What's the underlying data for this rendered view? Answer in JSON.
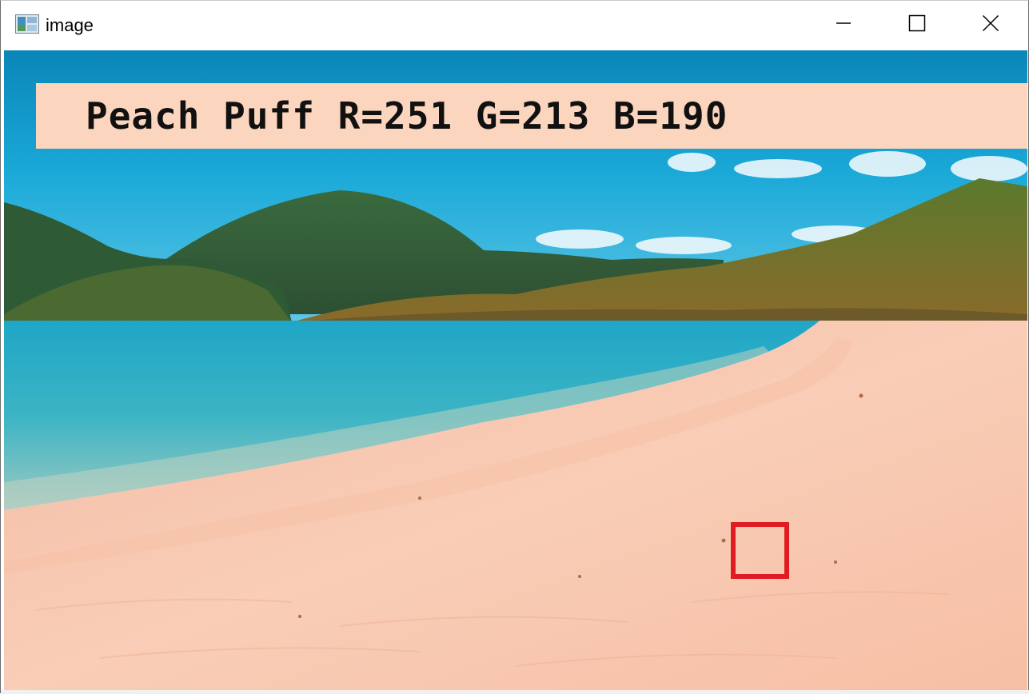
{
  "window": {
    "title": "image",
    "icons": {
      "app": "image-viewer-icon",
      "minimize": "minimize-icon",
      "maximize": "maximize-icon",
      "close": "close-icon"
    }
  },
  "overlay": {
    "label": "Peach Puff R=251 G=213 B=190",
    "color_name": "Peach Puff",
    "r": 251,
    "g": 213,
    "b": 190,
    "swatch_color": "#fbd5be",
    "marker_color": "#e11b22"
  }
}
